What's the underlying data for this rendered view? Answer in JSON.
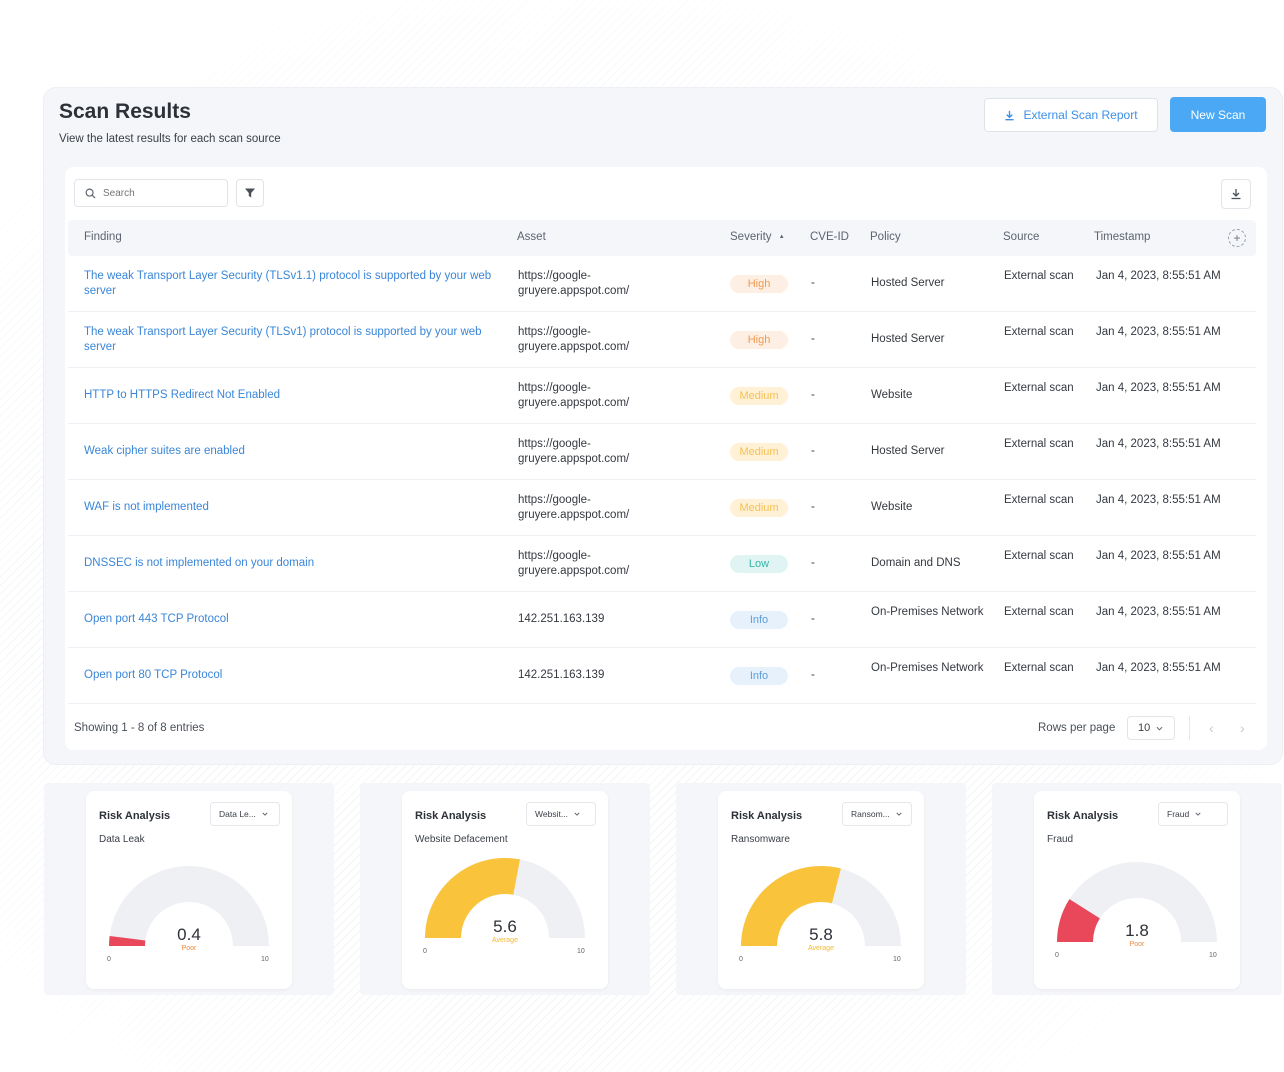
{
  "page": {
    "title": "Scan Results",
    "subtitle": "View the latest results for each scan source",
    "report_button": "External Scan Report",
    "new_scan_button": "New Scan"
  },
  "toolbar": {
    "search_placeholder": "Search",
    "filter_icon": "filter-icon",
    "download_icon": "download-icon"
  },
  "table": {
    "headers": {
      "finding": "Finding",
      "asset": "Asset",
      "severity": "Severity",
      "severity_sort": "▲",
      "cve": "CVE-ID",
      "policy": "Policy",
      "source": "Source",
      "timestamp": "Timestamp",
      "add_column": "+"
    },
    "rows": [
      {
        "finding": "The weak Transport Layer Security (TLSv1.1) protocol is supported by your web server",
        "asset": "https://google-gruyere.appspot.com/",
        "severity": "High",
        "cve": "-",
        "policy": "Hosted Server",
        "source": "External scan",
        "timestamp": "Jan 4, 2023, 8:55:51 AM"
      },
      {
        "finding": "The weak Transport Layer Security (TLSv1) protocol is supported by your web server",
        "asset": "https://google-gruyere.appspot.com/",
        "severity": "High",
        "cve": "-",
        "policy": "Hosted Server",
        "source": "External scan",
        "timestamp": "Jan 4, 2023, 8:55:51 AM"
      },
      {
        "finding": "HTTP to HTTPS Redirect Not Enabled",
        "asset": "https://google-gruyere.appspot.com/",
        "severity": "Medium",
        "cve": "-",
        "policy": "Website",
        "source": "External scan",
        "timestamp": "Jan 4, 2023, 8:55:51 AM"
      },
      {
        "finding": "Weak cipher suites are enabled",
        "asset": "https://google-gruyere.appspot.com/",
        "severity": "Medium",
        "cve": "-",
        "policy": "Hosted Server",
        "source": "External scan",
        "timestamp": "Jan 4, 2023, 8:55:51 AM"
      },
      {
        "finding": "WAF is not implemented",
        "asset": "https://google-gruyere.appspot.com/",
        "severity": "Medium",
        "cve": "-",
        "policy": "Website",
        "source": "External scan",
        "timestamp": "Jan 4, 2023, 8:55:51 AM"
      },
      {
        "finding": "DNSSEC is not implemented on your domain",
        "asset": "https://google-gruyere.appspot.com/",
        "severity": "Low",
        "cve": "-",
        "policy": "Domain and DNS",
        "source": "External scan",
        "timestamp": "Jan 4, 2023, 8:55:51 AM"
      },
      {
        "finding": "Open port 443 TCP Protocol",
        "asset": "142.251.163.139",
        "severity": "Info",
        "cve": "-",
        "policy": "On-Premises Network",
        "source": "External scan",
        "timestamp": "Jan 4, 2023, 8:55:51 AM"
      },
      {
        "finding": "Open port 80 TCP Protocol",
        "asset": "142.251.163.139",
        "severity": "Info",
        "cve": "-",
        "policy": "On-Premises Network",
        "source": "External scan",
        "timestamp": "Jan 4, 2023, 8:55:51 AM"
      }
    ],
    "footer": {
      "showing": "Showing 1 - 8 of 8 entries",
      "rows_per_page_label": "Rows per page",
      "rows_per_page_value": "10",
      "prev": "‹",
      "next": "›"
    }
  },
  "colors": {
    "accent": "#4aa8f5",
    "link": "#3a86d8",
    "gauge_yellow": "#f9c33c",
    "gauge_red": "#e8485a",
    "gauge_track": "#eef0f4"
  },
  "risk_cards": [
    {
      "title": "Risk Analysis",
      "select": "Data Le...",
      "subtitle": "Data Leak",
      "value": "0.4",
      "rating": "Poor",
      "score": 0.4,
      "min": "0",
      "max": "10"
    },
    {
      "title": "Risk Analysis",
      "select": "Websit...",
      "subtitle": "Website Defacement",
      "value": "5.6",
      "rating": "Average",
      "score": 5.6,
      "min": "0",
      "max": "10"
    },
    {
      "title": "Risk Analysis",
      "select": "Ransom...",
      "subtitle": "Ransomware",
      "value": "5.8",
      "rating": "Average",
      "score": 5.8,
      "min": "0",
      "max": "10"
    },
    {
      "title": "Risk Analysis",
      "select": "Fraud",
      "subtitle": "Fraud",
      "value": "1.8",
      "rating": "Poor",
      "score": 1.8,
      "min": "0",
      "max": "10"
    }
  ]
}
